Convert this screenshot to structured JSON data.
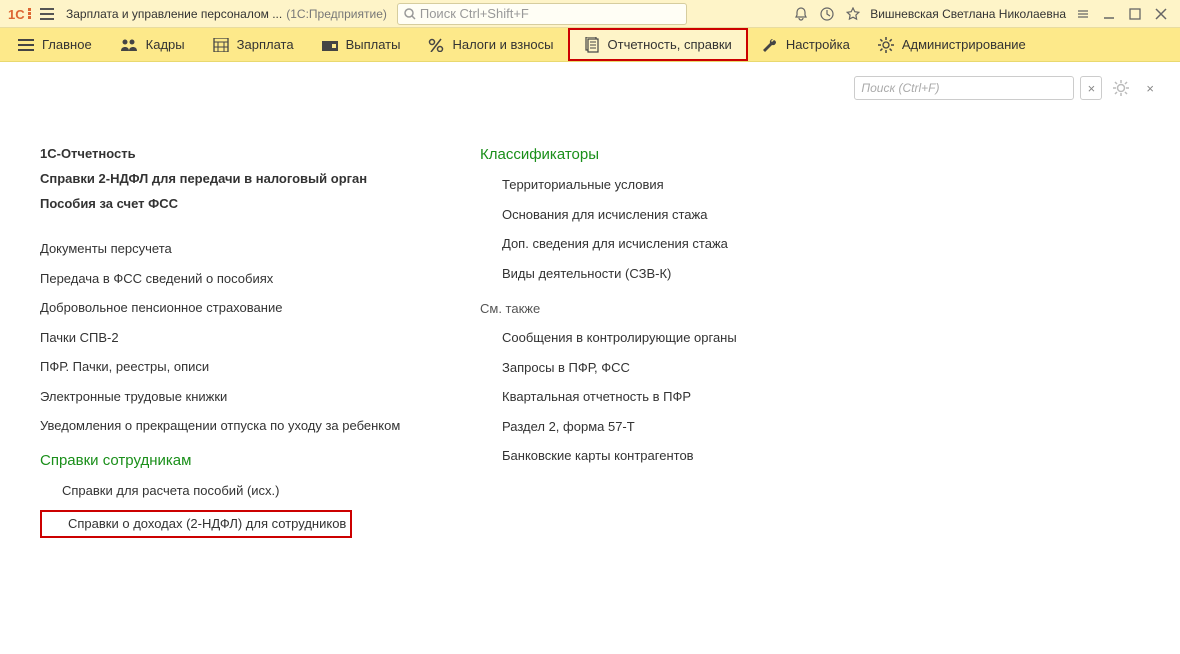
{
  "titlebar": {
    "app_title": "Зарплата и управление персоналом ...",
    "app_suffix": "(1С:Предприятие)",
    "search_placeholder": "Поиск Ctrl+Shift+F",
    "username": "Вишневская Светлана Николаевна"
  },
  "menu": {
    "items": [
      {
        "label": "Главное"
      },
      {
        "label": "Кадры"
      },
      {
        "label": "Зарплата"
      },
      {
        "label": "Выплаты"
      },
      {
        "label": "Налоги и взносы"
      },
      {
        "label": "Отчетность, справки"
      },
      {
        "label": "Настройка"
      },
      {
        "label": "Администрирование"
      }
    ]
  },
  "panel": {
    "search_placeholder": "Поиск (Ctrl+F)"
  },
  "left": {
    "top": [
      "1С-Отчетность",
      "Справки 2-НДФЛ для передачи в налоговый орган",
      "Пособия за счет ФСС"
    ],
    "mid": [
      "Документы персучета",
      "Передача в ФСС сведений о пособиях",
      "Добровольное пенсионное страхование",
      "Пачки СПВ-2",
      "ПФР. Пачки, реестры, описи",
      "Электронные трудовые книжки",
      "Уведомления о прекращении отпуска по уходу за ребенком"
    ],
    "section": "Справки сотрудникам",
    "sec_items": [
      "Справки для расчета пособий (исх.)",
      "Справки о доходах (2-НДФЛ) для сотрудников"
    ]
  },
  "right": {
    "section": "Классификаторы",
    "items": [
      "Территориальные условия",
      "Основания для исчисления стажа",
      "Доп. сведения для исчисления стажа",
      "Виды деятельности (СЗВ-К)"
    ],
    "see_also": "См. также",
    "see_items": [
      "Сообщения в контролирующие органы",
      "Запросы в ПФР, ФСС",
      "Квартальная отчетность в ПФР",
      "Раздел 2, форма 57-Т",
      "Банковские карты контрагентов"
    ]
  }
}
